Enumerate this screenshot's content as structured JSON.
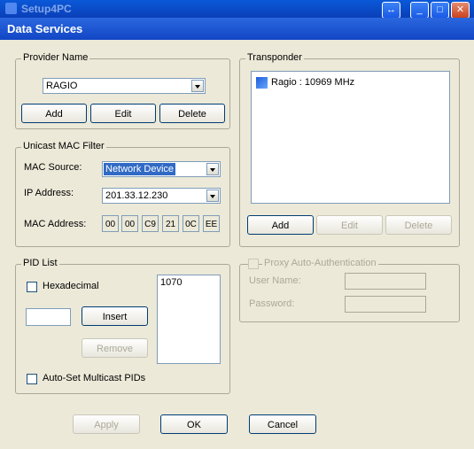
{
  "window": {
    "title": "Setup4PC",
    "caption": "Data Services"
  },
  "provider": {
    "group_label": "Provider Name",
    "selected": "RAGIO",
    "add": "Add",
    "edit": "Edit",
    "delete": "Delete"
  },
  "mac_filter": {
    "group_label": "Unicast MAC Filter",
    "source_label": "MAC Source:",
    "source_value": "Network Device",
    "ip_label": "IP Address:",
    "ip_value": "201.33.12.230",
    "mac_label": "MAC Address:",
    "mac_octets": [
      "00",
      "00",
      "C9",
      "21",
      "0C",
      "EE"
    ]
  },
  "transponder": {
    "group_label": "Transponder",
    "items": [
      "Ragio : 10969 MHz"
    ],
    "add": "Add",
    "edit": "Edit",
    "delete": "Delete"
  },
  "pid": {
    "group_label": "PID List",
    "hex_label": "Hexadecimal",
    "insert": "Insert",
    "remove": "Remove",
    "items": [
      "1070"
    ],
    "auto_label": "Auto-Set Multicast PIDs"
  },
  "proxy": {
    "label": "Proxy Auto-Authentication",
    "user_label": "User Name:",
    "password_label": "Password:"
  },
  "footer": {
    "apply": "Apply",
    "ok": "OK",
    "cancel": "Cancel"
  }
}
